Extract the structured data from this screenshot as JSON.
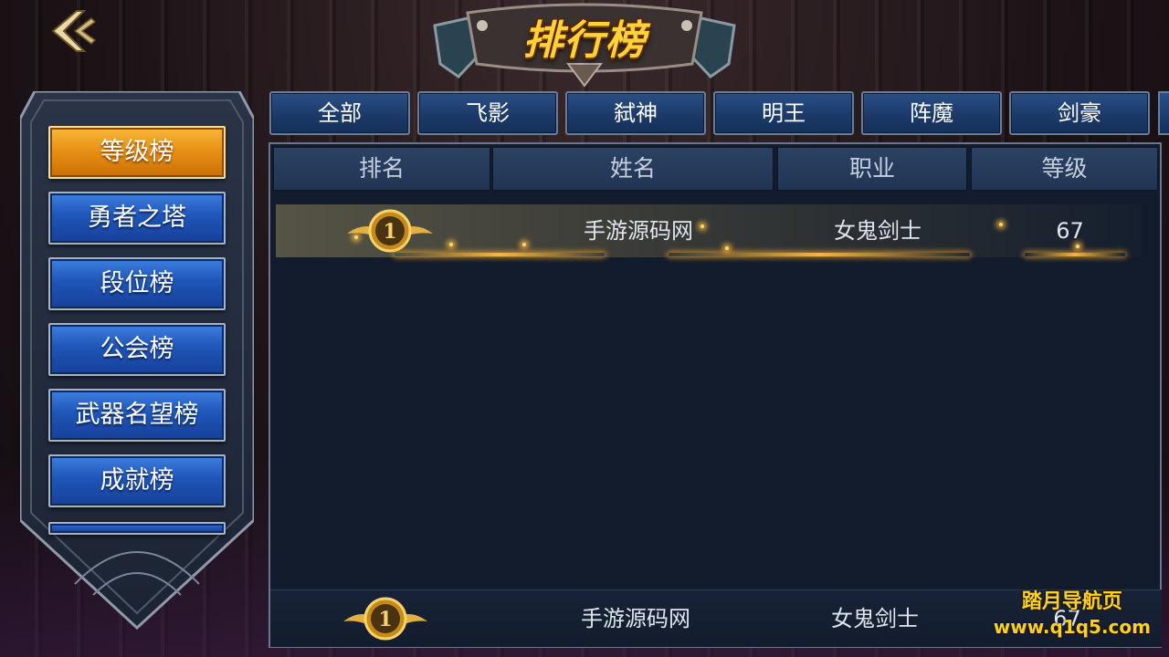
{
  "title": "排行榜",
  "sidebar": {
    "items": [
      {
        "label": "等级榜",
        "active": true
      },
      {
        "label": "勇者之塔",
        "active": false
      },
      {
        "label": "段位榜",
        "active": false
      },
      {
        "label": "公会榜",
        "active": false
      },
      {
        "label": "武器名望榜",
        "active": false
      },
      {
        "label": "成就榜",
        "active": false
      }
    ]
  },
  "tabs": [
    "全部",
    "飞影",
    "弑神",
    "明王",
    "阵魔",
    "剑豪"
  ],
  "table": {
    "columns": [
      "排名",
      "姓名",
      "职业",
      "等级"
    ],
    "rows": [
      {
        "rank": "1",
        "name": "手游源码网",
        "class": "女鬼剑士",
        "level": "67"
      }
    ]
  },
  "self_row": {
    "rank": "1",
    "name": "手游源码网",
    "class": "女鬼剑士",
    "level": "67"
  },
  "watermark": {
    "line1": "踏月导航页",
    "line2": "www.q1q5.com"
  },
  "colors": {
    "accent_gold": "#ffd23a",
    "active_tab_orange": "#e58e12",
    "button_blue": "#1f56b7",
    "panel_bg": "#121c2c"
  },
  "icons": {
    "back": "chevron-left-icon",
    "medal": "gold-medal-icon"
  }
}
